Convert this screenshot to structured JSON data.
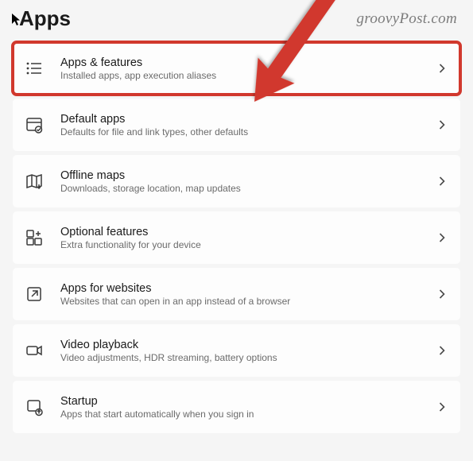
{
  "page_title": "Apps",
  "watermark": "groovyPost.com",
  "highlight_color": "#d1382d",
  "items": [
    {
      "icon": "apps-features-icon",
      "title": "Apps & features",
      "subtitle": "Installed apps, app execution aliases",
      "highlighted": true
    },
    {
      "icon": "default-apps-icon",
      "title": "Default apps",
      "subtitle": "Defaults for file and link types, other defaults",
      "highlighted": false
    },
    {
      "icon": "offline-maps-icon",
      "title": "Offline maps",
      "subtitle": "Downloads, storage location, map updates",
      "highlighted": false
    },
    {
      "icon": "optional-features-icon",
      "title": "Optional features",
      "subtitle": "Extra functionality for your device",
      "highlighted": false
    },
    {
      "icon": "apps-for-websites-icon",
      "title": "Apps for websites",
      "subtitle": "Websites that can open in an app instead of a browser",
      "highlighted": false
    },
    {
      "icon": "video-playback-icon",
      "title": "Video playback",
      "subtitle": "Video adjustments, HDR streaming, battery options",
      "highlighted": false
    },
    {
      "icon": "startup-icon",
      "title": "Startup",
      "subtitle": "Apps that start automatically when you sign in",
      "highlighted": false
    }
  ]
}
